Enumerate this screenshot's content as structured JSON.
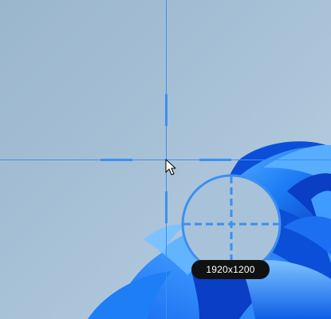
{
  "capture_overlay": {
    "resolution_readout": "1920x1200",
    "accent_color": "#3d8ff0",
    "magnifier_fill": "#a8c2d9"
  },
  "icons": {
    "cursor": "mouse-pointer-arrow-icon",
    "crosshair": "screen-capture-crosshair-icon",
    "magnifier": "magnifier-loupe-icon"
  },
  "wallpaper": {
    "style": "windows-11-bloom",
    "background_color": "#a6c0d6",
    "bloom_colors": [
      "#0b63e8",
      "#1d7ef5",
      "#4aa6ff",
      "#0a3ec4"
    ]
  }
}
